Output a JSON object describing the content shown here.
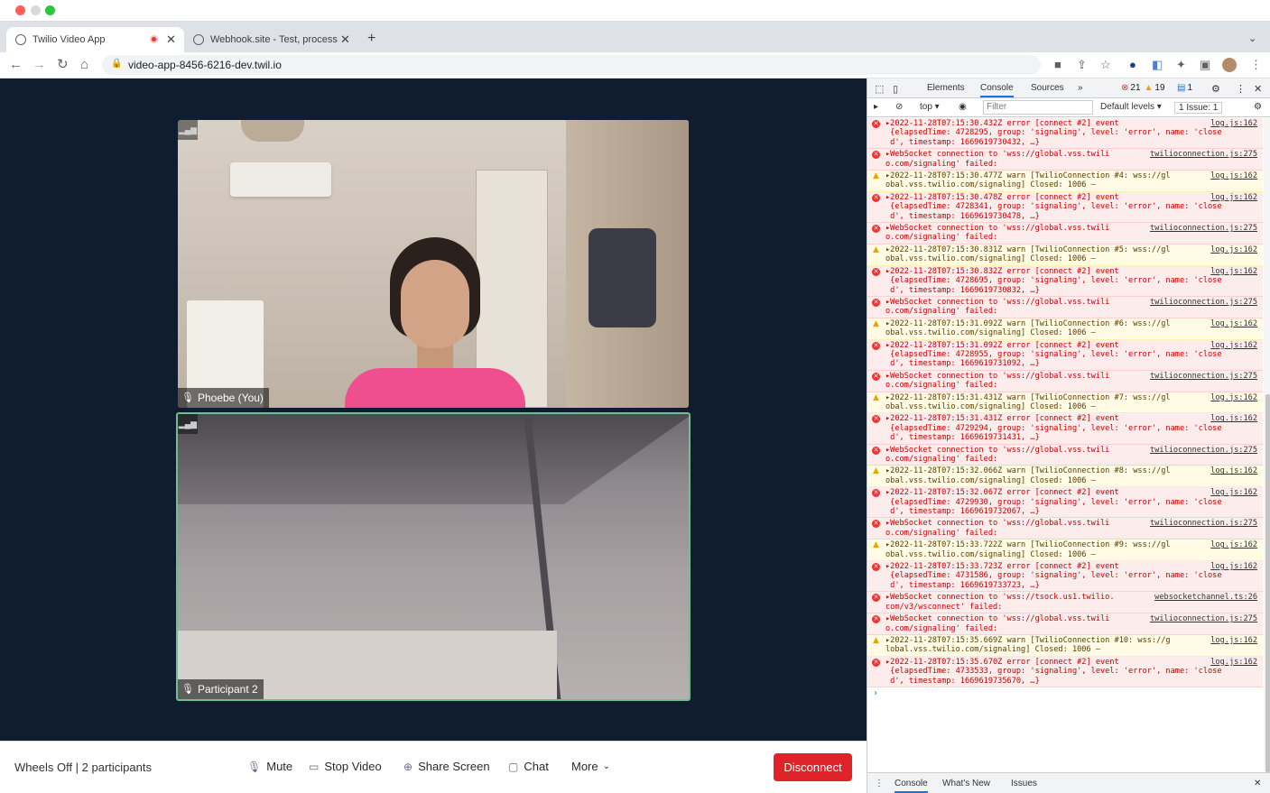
{
  "browser": {
    "tabs": [
      {
        "title": "Twilio Video App",
        "recording": true
      },
      {
        "title": "Webhook.site - Test, process a"
      }
    ],
    "new_tab": "+",
    "url": "video-app-8456-6216-dev.twil.io"
  },
  "video": {
    "participants": [
      {
        "name": "Phoebe (You)"
      },
      {
        "name": "Participant 2"
      }
    ]
  },
  "controls": {
    "room": "Wheels Off | 2 participants",
    "mute": "Mute",
    "stop_video": "Stop Video",
    "share_screen": "Share Screen",
    "chat": "Chat",
    "more": "More",
    "disconnect": "Disconnect"
  },
  "devtools": {
    "tabs": [
      "Elements",
      "Console",
      "Sources",
      "»"
    ],
    "active_tab": "Console",
    "errors": "21",
    "warnings": "19",
    "messages": "1",
    "context": "top ▾",
    "filter_placeholder": "Filter",
    "levels": "Default levels ▾",
    "issues": "1 Issue:  1",
    "drawer_tabs": [
      "Console",
      "What's New",
      "Issues"
    ],
    "log": [
      {
        "t": "err",
        "text": "▸2022-11-28T07:15:30.432Z error [connect #2] event\n {elapsedTime: 4728295, group: 'signaling', level: 'error', name: 'close\n d', timestamp: 1669619730432, …}",
        "src": "log.js:162"
      },
      {
        "t": "err",
        "text": "▸WebSocket connection to 'wss://global.vss.twili\no.com/signaling' failed:",
        "src": "twilioconnection.js:275"
      },
      {
        "t": "warn",
        "text": "▸2022-11-28T07:15:30.477Z warn [TwilioConnection #4: wss://gl\nobal.vss.twilio.com/signaling] Closed: 1006 –",
        "src": "log.js:162"
      },
      {
        "t": "err",
        "text": "▸2022-11-28T07:15:30.478Z error [connect #2] event\n {elapsedTime: 4728341, group: 'signaling', level: 'error', name: 'close\n d', timestamp: 1669619730478, …}",
        "src": "log.js:162"
      },
      {
        "t": "err",
        "text": "▸WebSocket connection to 'wss://global.vss.twili\no.com/signaling' failed:",
        "src": "twilioconnection.js:275"
      },
      {
        "t": "warn",
        "text": "▸2022-11-28T07:15:30.831Z warn [TwilioConnection #5: wss://gl\nobal.vss.twilio.com/signaling] Closed: 1006 –",
        "src": "log.js:162"
      },
      {
        "t": "err",
        "text": "▸2022-11-28T07:15:30.832Z error [connect #2] event\n {elapsedTime: 4728695, group: 'signaling', level: 'error', name: 'close\n d', timestamp: 1669619730832, …}",
        "src": "log.js:162"
      },
      {
        "t": "err",
        "text": "▸WebSocket connection to 'wss://global.vss.twili\no.com/signaling' failed:",
        "src": "twilioconnection.js:275"
      },
      {
        "t": "warn",
        "text": "▸2022-11-28T07:15:31.092Z warn [TwilioConnection #6: wss://gl\nobal.vss.twilio.com/signaling] Closed: 1006 –",
        "src": "log.js:162"
      },
      {
        "t": "err",
        "text": "▸2022-11-28T07:15:31.092Z error [connect #2] event\n {elapsedTime: 4728955, group: 'signaling', level: 'error', name: 'close\n d', timestamp: 1669619731092, …}",
        "src": "log.js:162"
      },
      {
        "t": "err",
        "text": "▸WebSocket connection to 'wss://global.vss.twili\no.com/signaling' failed:",
        "src": "twilioconnection.js:275"
      },
      {
        "t": "warn",
        "text": "▸2022-11-28T07:15:31.431Z warn [TwilioConnection #7: wss://gl\nobal.vss.twilio.com/signaling] Closed: 1006 –",
        "src": "log.js:162"
      },
      {
        "t": "err",
        "text": "▸2022-11-28T07:15:31.431Z error [connect #2] event\n {elapsedTime: 4729294, group: 'signaling', level: 'error', name: 'close\n d', timestamp: 1669619731431, …}",
        "src": "log.js:162"
      },
      {
        "t": "err",
        "text": "▸WebSocket connection to 'wss://global.vss.twili\no.com/signaling' failed:",
        "src": "twilioconnection.js:275"
      },
      {
        "t": "warn",
        "text": "▸2022-11-28T07:15:32.066Z warn [TwilioConnection #8: wss://gl\nobal.vss.twilio.com/signaling] Closed: 1006 –",
        "src": "log.js:162"
      },
      {
        "t": "err",
        "text": "▸2022-11-28T07:15:32.067Z error [connect #2] event\n {elapsedTime: 4729930, group: 'signaling', level: 'error', name: 'close\n d', timestamp: 1669619732067, …}",
        "src": "log.js:162"
      },
      {
        "t": "err",
        "text": "▸WebSocket connection to 'wss://global.vss.twili\no.com/signaling' failed:",
        "src": "twilioconnection.js:275"
      },
      {
        "t": "warn",
        "text": "▸2022-11-28T07:15:33.722Z warn [TwilioConnection #9: wss://gl\nobal.vss.twilio.com/signaling] Closed: 1006 –",
        "src": "log.js:162"
      },
      {
        "t": "err",
        "text": "▸2022-11-28T07:15:33.723Z error [connect #2] event\n {elapsedTime: 4731586, group: 'signaling', level: 'error', name: 'close\n d', timestamp: 1669619733723, …}",
        "src": "log.js:162"
      },
      {
        "t": "err",
        "text": "▸WebSocket connection to 'wss://tsock.us1.twilio.\ncom/v3/wsconnect' failed:",
        "src": "websocketchannel.ts:26"
      },
      {
        "t": "err",
        "text": "▸WebSocket connection to 'wss://global.vss.twili\no.com/signaling' failed:",
        "src": "twilioconnection.js:275"
      },
      {
        "t": "warn",
        "text": "▸2022-11-28T07:15:35.669Z warn [TwilioConnection #10: wss://g\nlobal.vss.twilio.com/signaling] Closed: 1006 –",
        "src": "log.js:162"
      },
      {
        "t": "err",
        "text": "▸2022-11-28T07:15:35.670Z error [connect #2] event\n {elapsedTime: 4733533, group: 'signaling', level: 'error', name: 'close\n d', timestamp: 1669619735670, …}",
        "src": "log.js:162"
      }
    ]
  }
}
